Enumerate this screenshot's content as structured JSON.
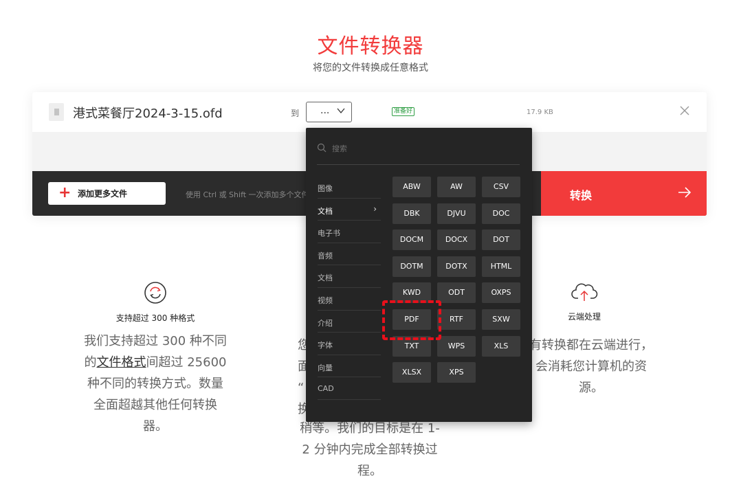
{
  "page": {
    "title": "文件转换器",
    "subtitle": "将您的文件转换成任意格式"
  },
  "file_row": {
    "file_name": "港式菜餐厅2024-3-15.ofd",
    "to_label": "到",
    "select_value": "...",
    "status": "准备好",
    "size": "17.9 KB"
  },
  "toolbar": {
    "add_label": "添加更多文件",
    "hint": "使用 Ctrl 或 Shift 一次添加多个文件",
    "convert_label": "转换"
  },
  "dropdown": {
    "search_placeholder": "搜索",
    "categories": [
      "图像",
      "文档",
      "电子书",
      "音频",
      "文档",
      "视频",
      "介绍",
      "字体",
      "向量",
      "CAD"
    ],
    "active_category": "文档",
    "formats": [
      "ABW",
      "AW",
      "CSV",
      "DBK",
      "DJVU",
      "DOC",
      "DOCM",
      "DOCX",
      "DOT",
      "DOTM",
      "DOTX",
      "HTML",
      "KWD",
      "ODT",
      "OXPS",
      "PDF",
      "RTF",
      "SXW",
      "TXT",
      "WPS",
      "XLS",
      "XLSX",
      "XPS"
    ],
    "highlighted_format": "PDF"
  },
  "features": [
    {
      "title": "支持超过 300 种格式",
      "desc_line1": "我们支持超过 300 种不同",
      "desc_line2_pre": "的",
      "desc_line2_link": "文件格式",
      "desc_line2_post": "间超过 25600",
      "desc_line3": "种不同的转换方式。数量",
      "desc_line4": "全面超越其他任何转换",
      "desc_line5": "器。"
    },
    {
      "title": "",
      "desc_line1": "您",
      "desc_line2": "面",
      "desc_line3": "“",
      "desc_line4": "换",
      "desc_line5": "稍等。我们的目标是在 1-",
      "desc_line6": "2 分钟内完成全部转换过",
      "desc_line7": "程。"
    },
    {
      "title": "云端处理",
      "desc_line1": "有转换都在云端进行，",
      "desc_line2": "会消耗您计算机的资",
      "desc_line3": "源。"
    }
  ],
  "colors": {
    "accent": "#f23b3b",
    "dropdown_bg": "#252525",
    "format_button": "#3b3b3b",
    "highlight": "#e8101b",
    "status_green": "#2f9e44"
  },
  "icons": {
    "file": "document-icon",
    "close": "close-icon",
    "plus": "plus-icon",
    "arrow": "arrow-right-icon",
    "search": "search-icon",
    "chevron": "chevron-right-icon",
    "formats_feature": "refresh-circle-icon",
    "cloud_feature": "cloud-upload-icon"
  }
}
